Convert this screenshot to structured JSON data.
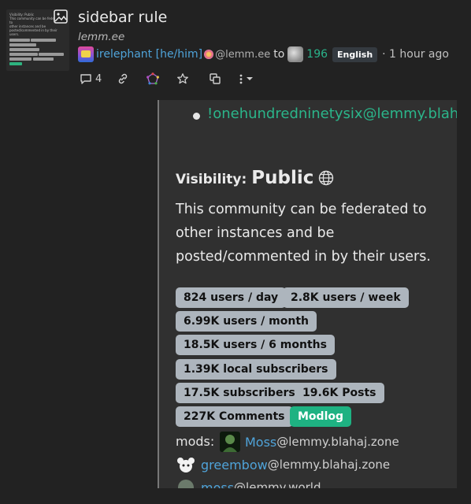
{
  "post": {
    "title": "sidebar rule",
    "domain": "lemm.ee",
    "author_name": "irelephant [he/him]",
    "author_instance": "@lemm.ee",
    "to_text": "to",
    "community_count": "196",
    "language": "English",
    "time_ago": "· 1 hour ago",
    "comments_count": "4"
  },
  "thumbnail": {
    "line1": "Visibility: Public",
    "line2": "This community can be federated to",
    "line3": "other instances and be",
    "line4": "posted/commented in by their users."
  },
  "sidebar": {
    "community_link": "!onehundredninetysix@lemmy.blahaj.zone",
    "visibility_label": "Visibility:",
    "visibility_value": "Public",
    "description": "This community can be federated to other instances and be posted/commented in by their users.",
    "badges": {
      "users_day": "824 users / day",
      "users_week": "2.8K users / week",
      "users_month": "6.99K users / month",
      "users_6months": "18.5K users / 6 months",
      "local_subscribers": "1.39K local subscribers",
      "subscribers": "17.5K subscribers",
      "posts": "19.6K Posts",
      "comments": "227K Comments",
      "modlog": "Modlog"
    },
    "mods_label": "mods:",
    "mods": [
      {
        "name": "Moss",
        "instance": "@lemmy.blahaj.zone"
      },
      {
        "name": "greembow",
        "instance": "@lemmy.blahaj.zone"
      },
      {
        "name": "moss",
        "instance": "@lemmy.world"
      }
    ]
  },
  "colors": {
    "background": "#222222",
    "panel": "#303030",
    "link_green": "#2bb58a",
    "user_blue": "#4fa3d9",
    "badge_gray": "#adb5bd",
    "modlog_green": "#1eb282"
  }
}
